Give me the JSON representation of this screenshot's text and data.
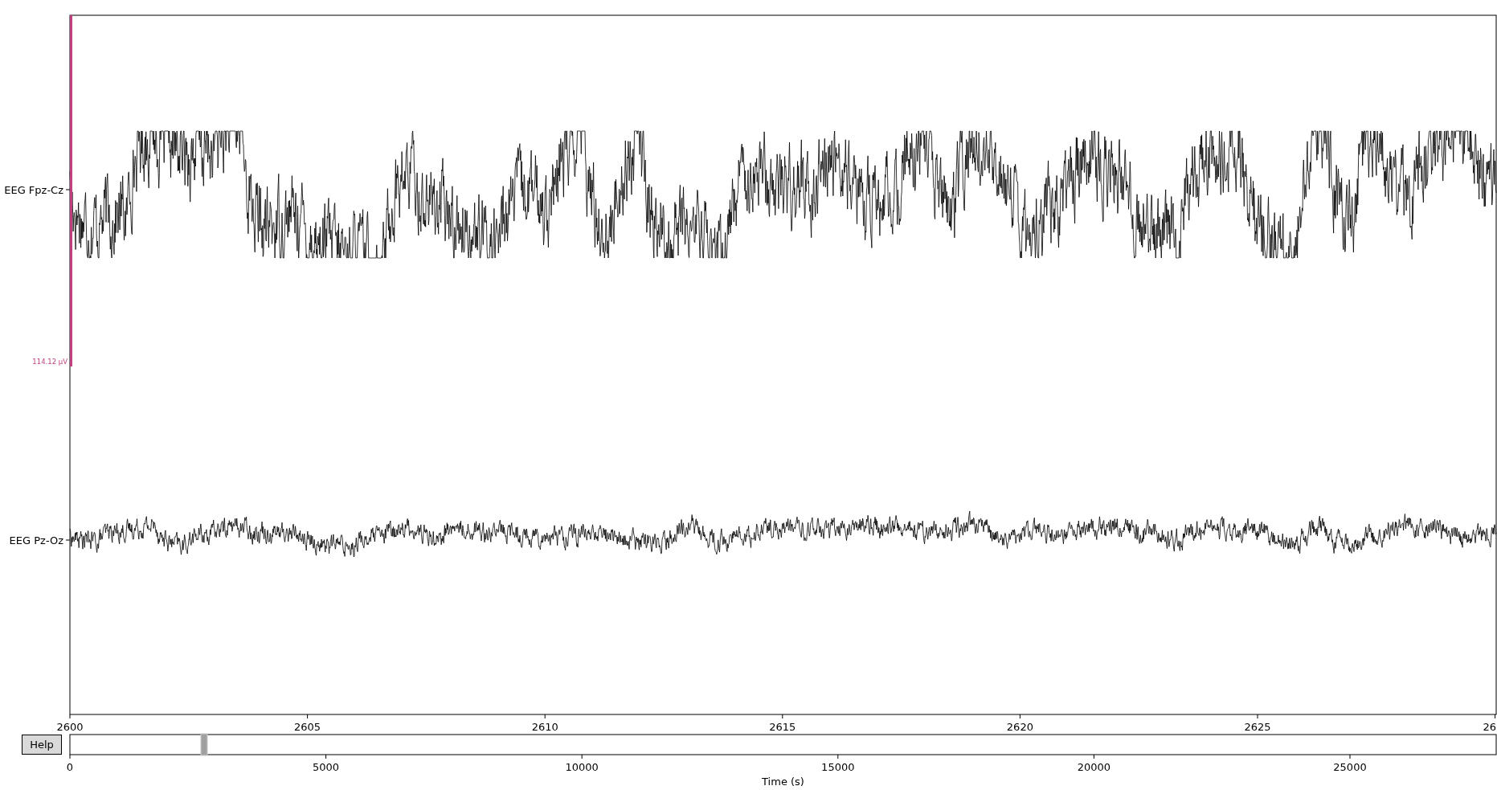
{
  "channels": [
    {
      "name": "EEG Fpz-Cz",
      "kind": "clipped"
    },
    {
      "name": "EEG Pz-Oz",
      "kind": "normal"
    }
  ],
  "scale_bar": {
    "label": "114.12 µV"
  },
  "time_axis": {
    "ticks": [
      "2600",
      "2605",
      "2610",
      "2615",
      "2620",
      "2625",
      "26"
    ],
    "label": "Time (s)"
  },
  "help_button": {
    "label": "Help"
  },
  "overview_axis": {
    "ticks": [
      "0",
      "5000",
      "10000",
      "15000",
      "20000",
      "25000"
    ]
  }
}
